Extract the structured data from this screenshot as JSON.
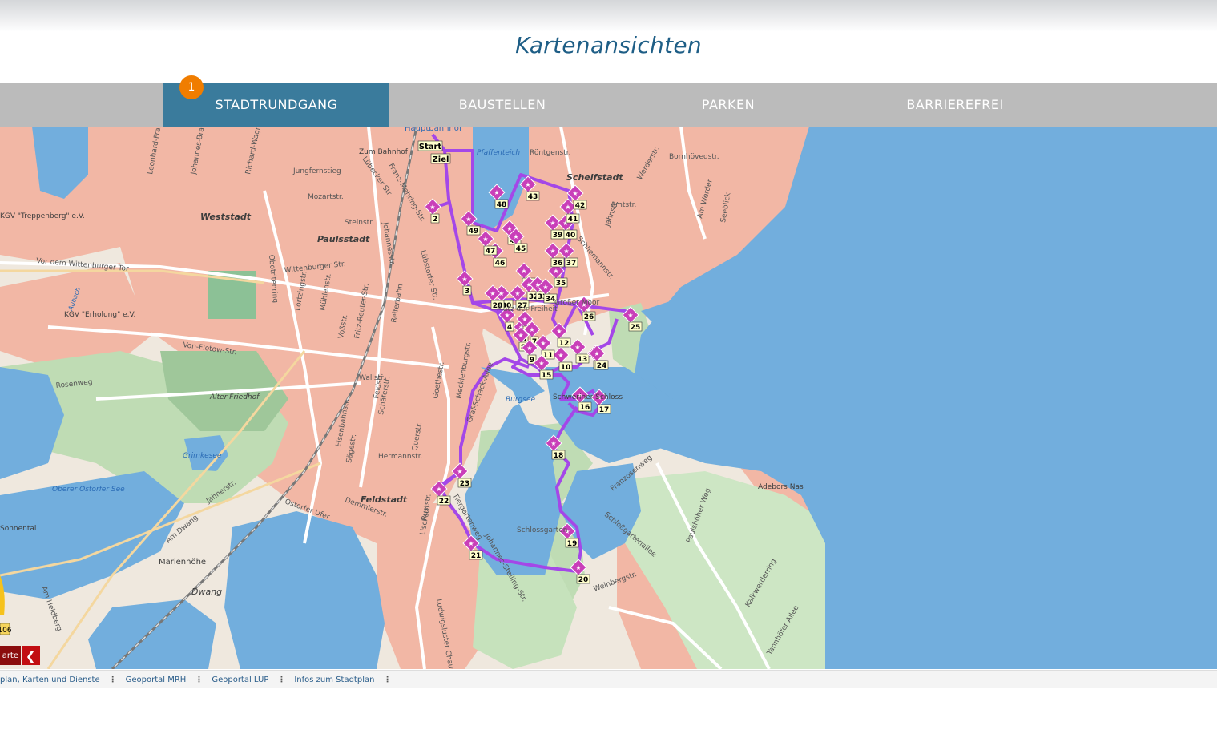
{
  "page_title": "Kartenansichten",
  "tabs": [
    {
      "label": "STADTRUNDGANG",
      "active": true,
      "badge": "1"
    },
    {
      "label": "BAUSTELLEN",
      "active": false
    },
    {
      "label": "PARKEN",
      "active": false
    },
    {
      "label": "BARRIEREFREI",
      "active": false
    }
  ],
  "colors": {
    "accent": "#3a7b9c",
    "badge": "#f07d00",
    "route": "#a447e8",
    "water": "#72aedd",
    "title": "#1e5e86"
  },
  "map": {
    "labels": {
      "hauptbahnhof": "Hauptbahnhof",
      "zum_bahnhof": "Zum Bahnhof",
      "pfaffenteich": "Pfaffenteich",
      "schelfstadt": "Schelfstadt",
      "weststadt": "Weststadt",
      "paulsstadt": "Paulsstadt",
      "feldstadt": "Feldstadt",
      "burgsee": "Burgsee",
      "schweriner_schloss": "Schweriner Schloss",
      "alter_friedhof": "Alter Friedhof",
      "grimkesee": "Grimkesee",
      "oberer_ostorfer_see": "Oberer Ostorfer See",
      "sonnental": "Sonnental",
      "marienhoehe": "Marienhöhe",
      "dwang": "Dwang",
      "adebors_nas": "Adebors Nas",
      "kgv_treppenberg": "KGV \"Treppenberg\" e.V.",
      "kgv_erholung": "KGV \"Erholung\" e.V.",
      "aubach": "Aubach",
      "start": "Start",
      "ziel": "Ziel"
    },
    "streets": [
      "Jungfernstieg",
      "Mozartstr.",
      "Steinstr.",
      "Wittenburger Str.",
      "Vor dem Wittenburger Tor",
      "Von-Flotow-Str.",
      "Rosenweg",
      "Wallstr.",
      "Obotritenring",
      "Johannesstr.",
      "Lübecker Str.",
      "Franz-Mehring-Str.",
      "Röntgenstr.",
      "Amtstr.",
      "Werderstr.",
      "Bornhövedstr.",
      "Am Werder",
      "Seeblick",
      "Jahnstr.",
      "Schliemannstr.",
      "Großer Moor",
      "Graf-Schack-Allee",
      "Mecklenburgstr.",
      "Goethestr.",
      "Feldstr.",
      "Schäferstr.",
      "Hermannstr.",
      "Ostorfer Ufer",
      "Demmlerstr.",
      "Lischstr.",
      "Tiergartenweg",
      "Schlossgarten",
      "Johannes-Stelling-Str.",
      "Ludwigsluster Chaussee",
      "Franzosenweg",
      "Schloßgartenallee",
      "Paulshöher Weg",
      "Weinbergstr.",
      "Kalkwerderring",
      "Tannhöfer Allee",
      "Am Heidberg",
      "Am Dwang",
      "Jahnerstr.",
      "Richard-Wagner-Str.",
      "Johannes-Brahms-Str.",
      "Leonhard-Frank-Str.",
      "Lortzingstr.",
      "Mühlenstr.",
      "Voßstr.",
      "Fritz-Reuter-Str.",
      "Reiferbahn",
      "Eisenbahnstr.",
      "Querstr.",
      "Sägestr.",
      "Platz der Freiheit",
      "Ruststr.",
      "Lübstorfer Str."
    ],
    "stops": [
      "2",
      "3",
      "4",
      "5",
      "6",
      "7",
      "8",
      "9",
      "10",
      "11",
      "12",
      "13",
      "14",
      "15",
      "16",
      "17",
      "18",
      "19",
      "20",
      "21",
      "22",
      "23",
      "24",
      "25",
      "26",
      "27",
      "30",
      "31",
      "32",
      "33",
      "35",
      "36",
      "37",
      "39",
      "40",
      "41",
      "42",
      "43",
      "44",
      "45",
      "46",
      "47",
      "48",
      "49",
      "34",
      "28"
    ],
    "road_badge": "106"
  },
  "controls": {
    "karte_label": "arte",
    "collapse_icon": "chevron-left-icon"
  },
  "footer_links": [
    "plan, Karten und Dienste",
    "Geoportal MRH",
    "Geoportal LUP",
    "Infos zum Stadtplan"
  ]
}
